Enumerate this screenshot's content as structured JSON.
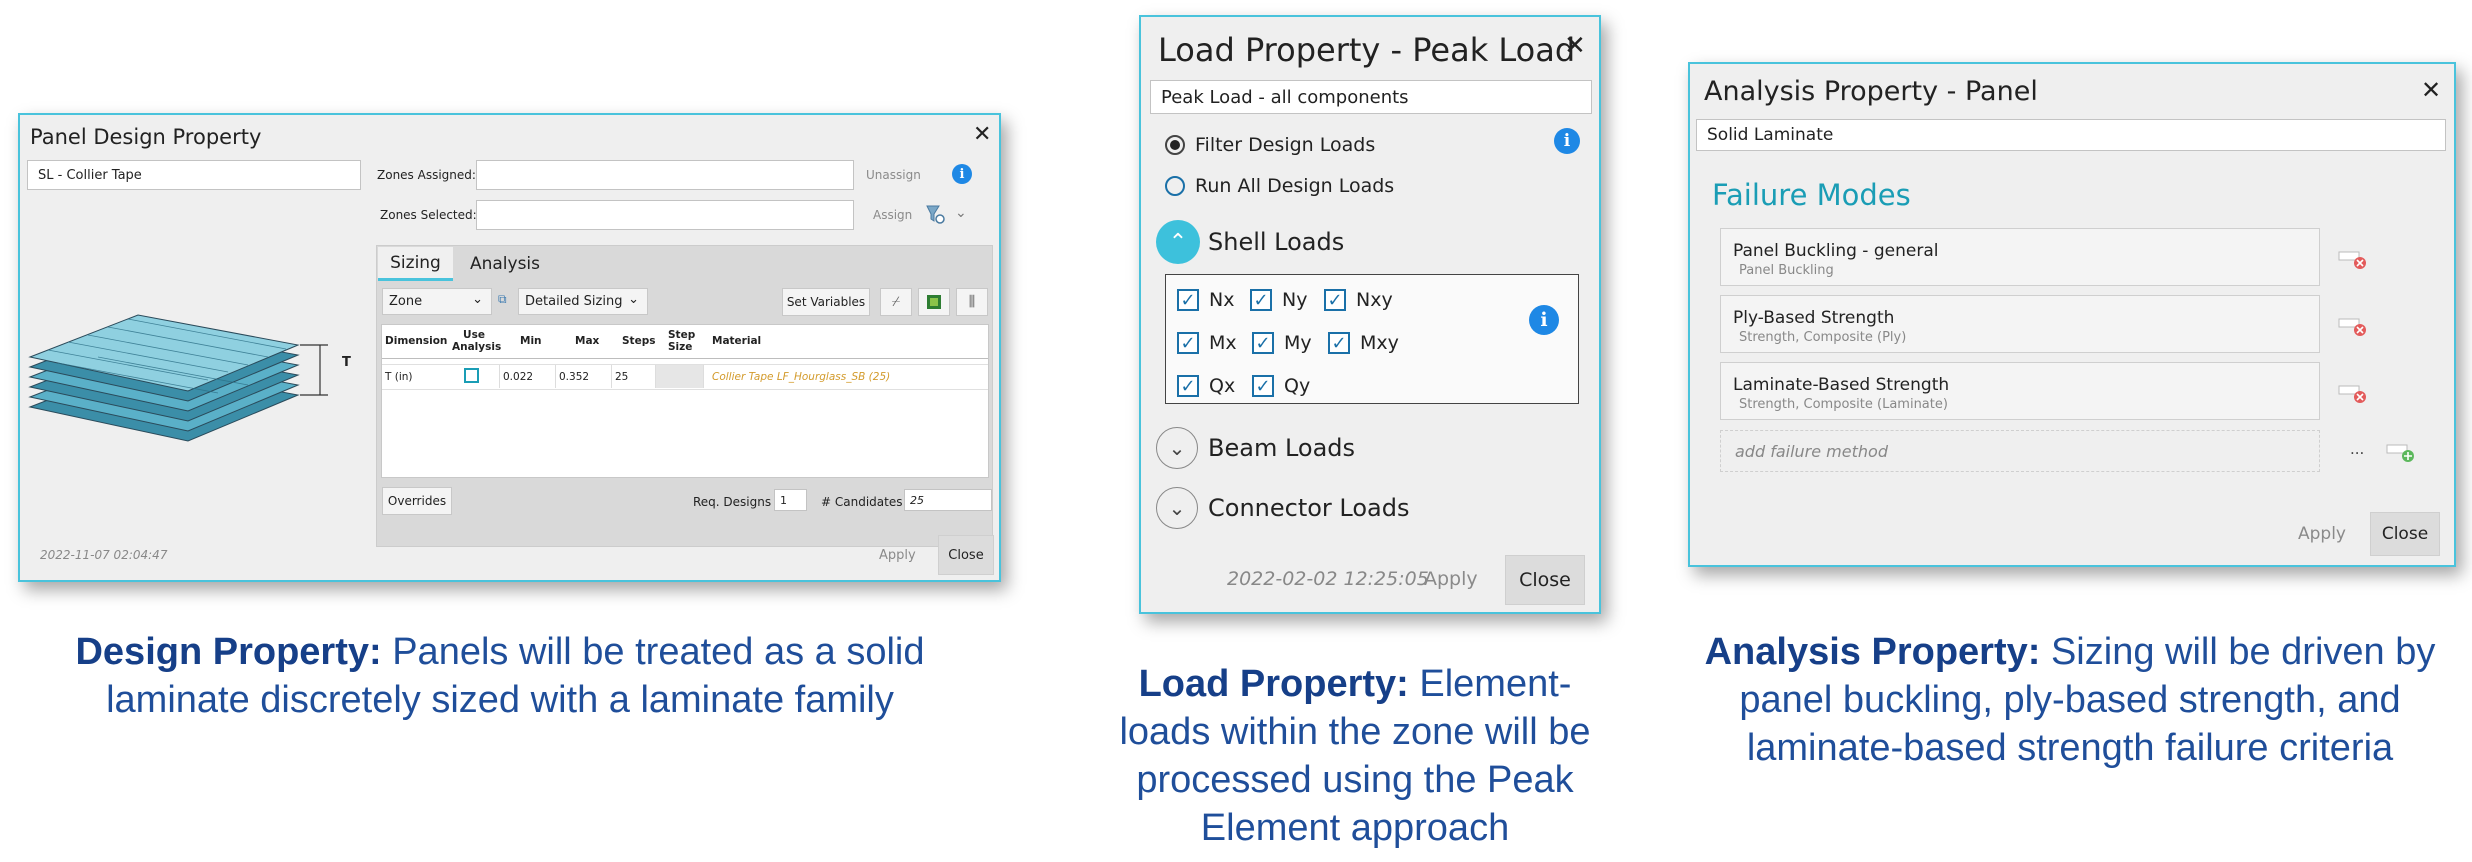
{
  "design": {
    "title": "Panel Design Property",
    "name_value": "SL - Collier Tape",
    "zones_assigned_label": "Zones Assigned:",
    "zones_selected_label": "Zones Selected:",
    "unassign_label": "Unassign",
    "assign_label": "Assign",
    "tabs": [
      "Sizing",
      "Analysis"
    ],
    "zone_select": "Zone",
    "sizing_select": "Detailed Sizing",
    "set_variables_label": "Set Variables",
    "table": {
      "headers": [
        "Dimension",
        "Use Analysis",
        "Min",
        "Max",
        "Steps",
        "Step Size",
        "Material"
      ],
      "rows": [
        {
          "dimension": "T (in)",
          "min": "0.022",
          "max": "0.352",
          "steps": "25",
          "step_size": "",
          "material": "Collier Tape LF_Hourglass_SB (25)"
        }
      ]
    },
    "overrides_label": "Overrides",
    "req_designs_label": "Req. Designs",
    "req_designs_value": "1",
    "candidates_label": "# Candidates",
    "candidates_value": "25",
    "timestamp": "2022-11-07 02:04:47",
    "apply_label": "Apply",
    "close_label": "Close",
    "dim_label": "T"
  },
  "load": {
    "title": "Load Property - Peak Load",
    "name_value": "Peak Load - all components",
    "radio_options": [
      "Filter Design Loads",
      "Run All Design Loads"
    ],
    "sections": {
      "shell": "Shell Loads",
      "beam": "Beam Loads",
      "connector": "Connector Loads"
    },
    "checkboxes": [
      "Nx",
      "Ny",
      "Nxy",
      "Mx",
      "My",
      "Mxy",
      "Qx",
      "Qy"
    ],
    "timestamp": "2022-02-02 12:25:05",
    "apply_label": "Apply",
    "close_label": "Close"
  },
  "analysis": {
    "title": "Analysis Property - Panel",
    "name_value": "Solid Laminate",
    "section_title": "Failure Modes",
    "failure_modes": [
      {
        "name": "Panel Buckling - general",
        "sub": "Panel Buckling"
      },
      {
        "name": "Ply-Based Strength",
        "sub": "Strength, Composite (Ply)"
      },
      {
        "name": "Laminate-Based Strength",
        "sub": "Strength, Composite (Laminate)"
      }
    ],
    "add_placeholder": "add failure method",
    "more_label": "...",
    "apply_label": "Apply",
    "close_label": "Close"
  },
  "captions": {
    "design_bold": "Design Property:",
    "design_rest": " Panels will be treated as a solid laminate discretely sized with a laminate family",
    "load_bold": "Load Property:",
    "load_rest": " Element-loads within the zone will be processed using the Peak Element approach",
    "analysis_bold": "Analysis Property:",
    "analysis_rest": " Sizing will be driven by panel buckling, ply-based strength, and laminate-based strength failure criteria"
  },
  "colors": {
    "border": "#49c3dc",
    "caption_blue": "#1f4e9a",
    "accent_teal": "#1a9db5",
    "material_orange": "#d39b2c",
    "info_blue": "#1e88e5"
  }
}
